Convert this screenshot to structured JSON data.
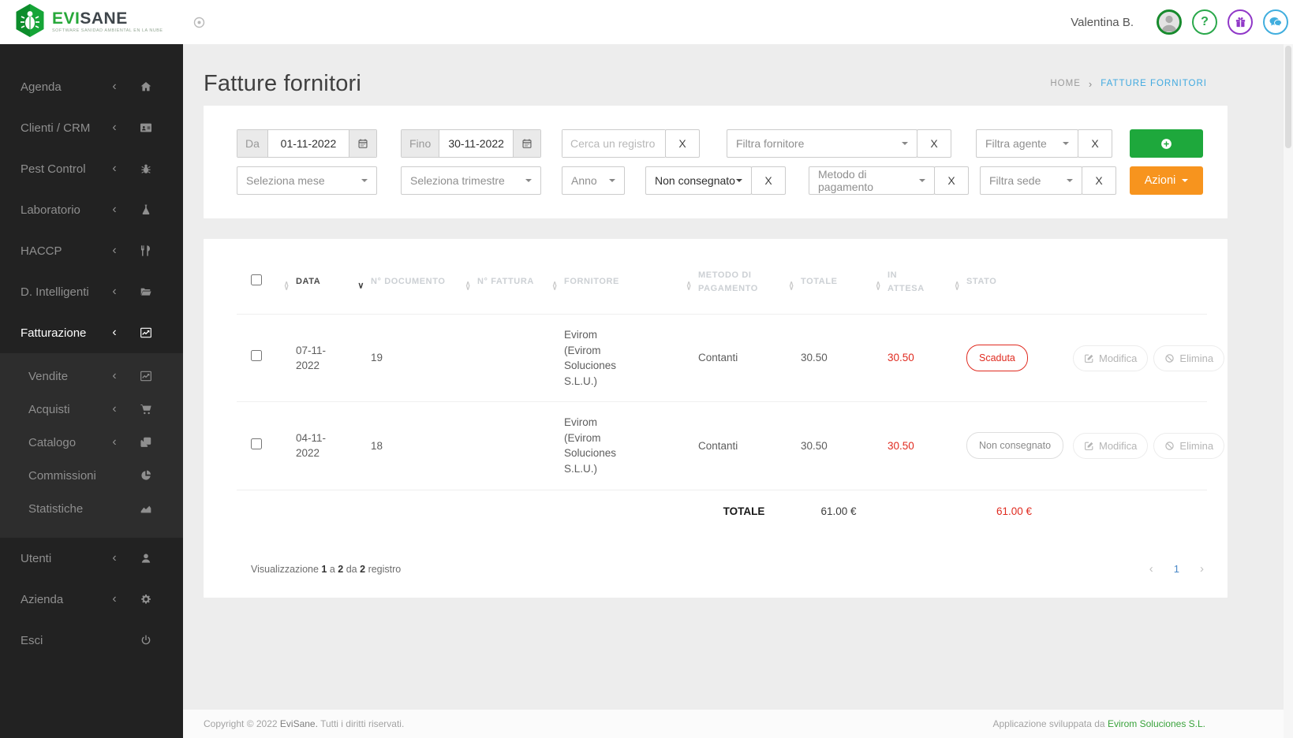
{
  "topbar": {
    "brand_evi": "EVI",
    "brand_sane": "SANE",
    "brand_tagline": "SOFTWARE SANIDAD AMBIENTAL EN LA NUBE",
    "user_name": "Valentina B.",
    "help_glyph": "?"
  },
  "sidebar": {
    "chevron": "‹",
    "items": [
      {
        "label": "Agenda",
        "icon": "home-icon"
      },
      {
        "label": "Clienti / CRM",
        "icon": "id-card-icon"
      },
      {
        "label": "Pest Control",
        "icon": "bug-icon"
      },
      {
        "label": "Laboratorio",
        "icon": "flask-icon"
      },
      {
        "label": "HACCP",
        "icon": "utensils-icon"
      },
      {
        "label": "D. Intelligenti",
        "icon": "folder-open-icon"
      },
      {
        "label": "Fatturazione",
        "icon": "chart-line-icon"
      }
    ],
    "submenu": [
      {
        "label": "Vendite",
        "icon": "chart-line-icon"
      },
      {
        "label": "Acquisti",
        "icon": "cart-icon"
      },
      {
        "label": "Catalogo",
        "icon": "clone-icon"
      },
      {
        "label": "Commissioni",
        "icon": "pie-chart-icon"
      },
      {
        "label": "Statistiche",
        "icon": "area-chart-icon"
      }
    ],
    "bottom": [
      {
        "label": "Utenti",
        "icon": "user-icon"
      },
      {
        "label": "Azienda",
        "icon": "gear-icon"
      },
      {
        "label": "Esci",
        "icon": "power-icon"
      }
    ]
  },
  "page": {
    "title": "Fatture fornitori",
    "breadcrumb_home": "HOME",
    "breadcrumb_sep": "›",
    "breadcrumb_current": "FATTURE FORNITORI"
  },
  "filters": {
    "da_label": "Da",
    "da_value": "01-11-2022",
    "fino_label": "Fino",
    "fino_value": "30-11-2022",
    "search_placeholder": "Cerca un registro",
    "clear_label": "X",
    "fornitore_placeholder": "Filtra fornitore",
    "agente_placeholder": "Filtra agente",
    "mese_placeholder": "Seleziona mese",
    "trimestre_placeholder": "Seleziona trimestre",
    "anno_label": "Anno",
    "stato_value": "Non consegnato",
    "metodo_placeholder": "Metodo di pagamento",
    "sede_placeholder": "Filtra sede",
    "azioni_label": "Azioni"
  },
  "table": {
    "headers": {
      "data": "DATA",
      "documento": "N° DOCUMENTO",
      "fattura": "N° FATTURA",
      "fornitore": "FORNITORE",
      "metodo": "METODO DI PAGAMENTO",
      "totale": "TOTALE",
      "in_attesa": "IN ATTESA",
      "stato": "STATO"
    },
    "sort_up": "∧",
    "sort_down": "∨",
    "rows": [
      {
        "data": "07-11-2022",
        "documento": "19",
        "fattura": "",
        "fornitore": "Evirom (Evirom Soluciones S.L.U.)",
        "metodo": "Contanti",
        "totale": "30.50",
        "in_attesa": "30.50",
        "stato": "Scaduta",
        "modifica": "Modifica",
        "elimina": "Elimina"
      },
      {
        "data": "04-11-2022",
        "documento": "18",
        "fattura": "",
        "fornitore": "Evirom (Evirom Soluciones S.L.U.)",
        "metodo": "Contanti",
        "totale": "30.50",
        "in_attesa": "30.50",
        "stato": "Non consegnato",
        "modifica": "Modifica",
        "elimina": "Elimina"
      }
    ],
    "totals": {
      "label": "TOTALE",
      "totale": "61.00 €",
      "in_attesa": "61.00 €"
    },
    "info": {
      "t1": "Visualizzazione",
      "n1": "1",
      "t2": "a",
      "n2": "2",
      "t3": "da",
      "n3": "2",
      "t4": "registro"
    },
    "pagination": {
      "prev": "‹",
      "page": "1",
      "next": "›"
    }
  },
  "footer": {
    "copyright_prefix": "Copyright © 2022",
    "brand": "EviSane.",
    "rights": "Tutti i diritti riservati.",
    "dev_prefix": "Applicazione sviluppata da",
    "dev_brand": "Evirom Soluciones S.L."
  },
  "colors": {
    "accent_green": "#1ea83c",
    "accent_orange": "#f7941e",
    "danger_red": "#e02b20",
    "link_blue": "#3fa9e0",
    "sidebar_bg": "#222222"
  }
}
